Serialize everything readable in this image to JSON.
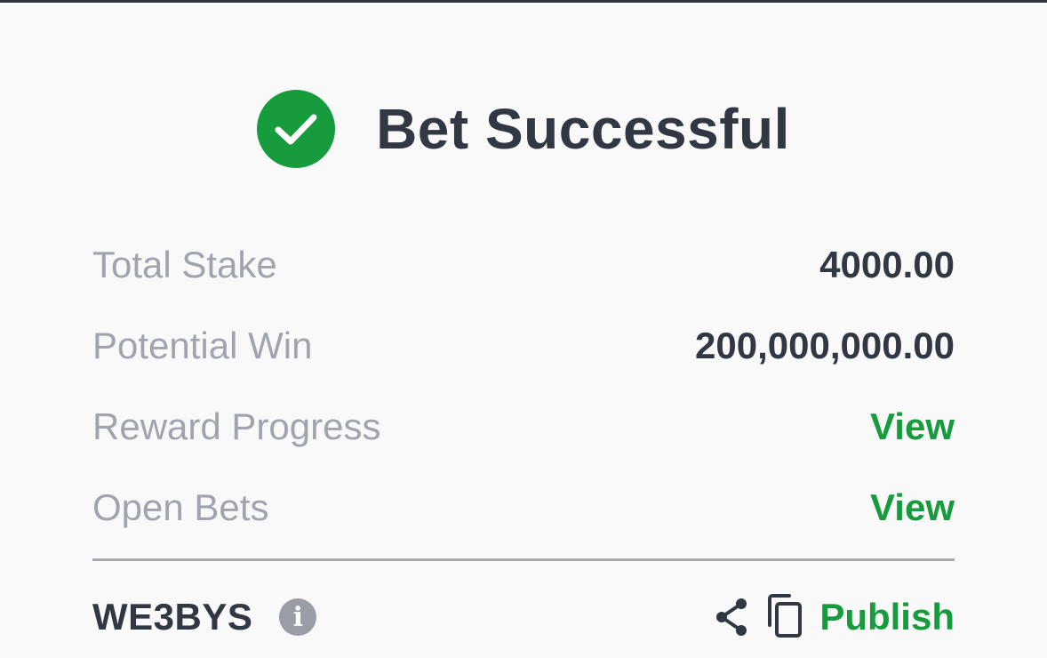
{
  "header": {
    "title": "Bet Successful",
    "icon": "check-circle-icon"
  },
  "rows": [
    {
      "label": "Total Stake",
      "value": "4000.00"
    },
    {
      "label": "Potential Win",
      "value": "200,000,000.00"
    },
    {
      "label": "Reward Progress",
      "value": "View"
    },
    {
      "label": "Open Bets",
      "value": "View"
    }
  ],
  "footer": {
    "booking_code": "WE3BYS",
    "info_icon_glyph": "i",
    "share_icon": "share-icon",
    "copy_icon": "copy-icon",
    "publish_label": "Publish"
  },
  "colors": {
    "accent": "#169b3d",
    "text": "#323744",
    "muted": "#a1a4ae"
  }
}
